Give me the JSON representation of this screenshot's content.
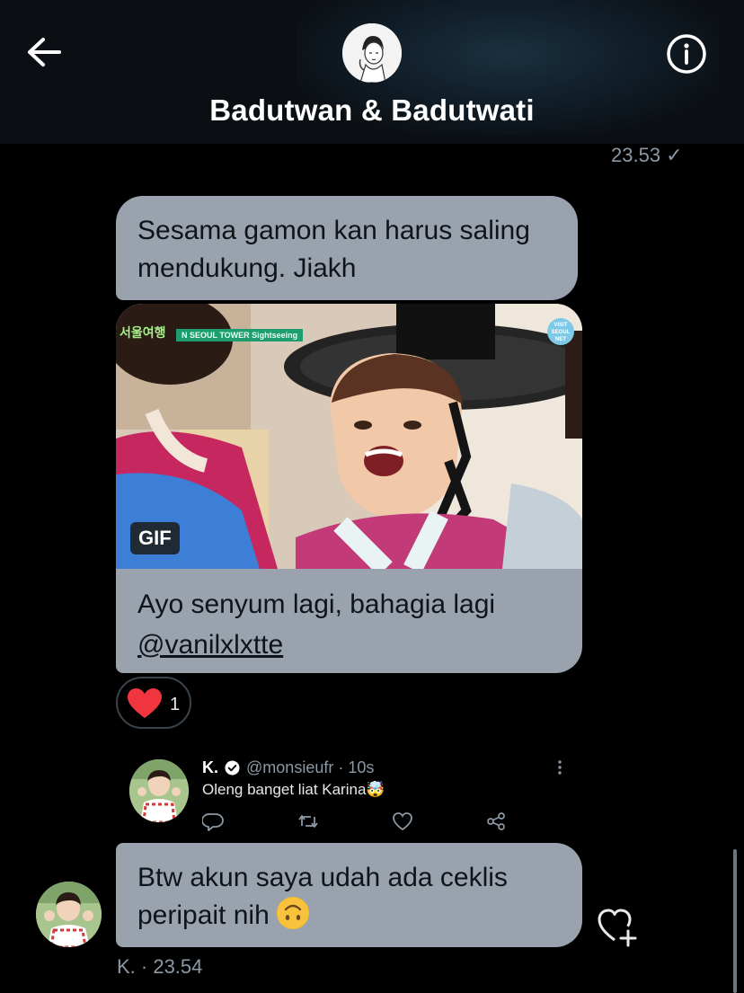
{
  "header": {
    "title": "Badutwan & Badutwati",
    "back_icon": "arrow-left-icon",
    "info_icon": "info-circle-icon"
  },
  "messages": {
    "read_time": "23.53 ✓",
    "bubble1_text": "Sesama gamon kan harus saling mendukung. Jiakh",
    "gif": {
      "badge": "GIF",
      "banner_text": "N SEOUL TOWER Sightseeing",
      "logo_text": "서울여행",
      "corner_badge": "VISIT SEOUL NET"
    },
    "caption_line1": "Ayo senyum lagi, bahagia lagi",
    "caption_mention": "@vanilxlxtte",
    "reaction_count": "1",
    "bubble2_text": "Btw akun saya udah ada ceklis peripait nih",
    "sender_meta": "K.  · 23.54"
  },
  "tweet": {
    "name": "K.",
    "handle": "@monsieufr",
    "dot": " · ",
    "time": "10s",
    "text": "Oleng banget liat Karina🤯",
    "actions": [
      "reply-icon",
      "retweet-icon",
      "like-icon",
      "share-icon"
    ]
  },
  "colors": {
    "bubble": "#9aa3ad",
    "background": "#000000",
    "secondary_text": "#8b98a5",
    "heart": "#f0353f",
    "verified": "#ffffff"
  }
}
